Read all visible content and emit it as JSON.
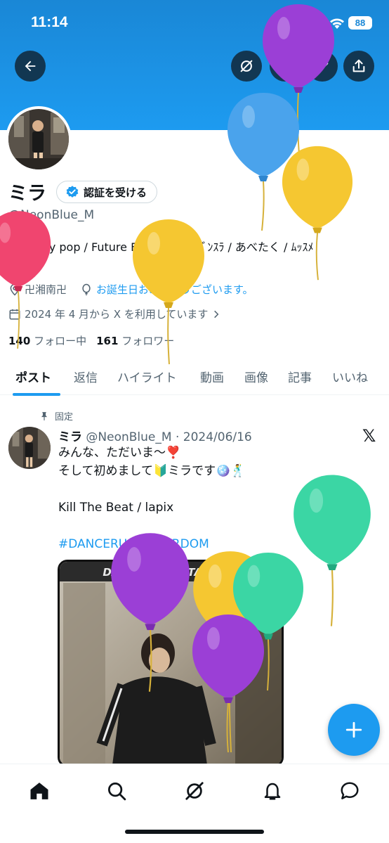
{
  "status_bar": {
    "time": "11:14",
    "battery": "88"
  },
  "profile": {
    "name": "ミラ",
    "verify_label": "認証を受ける",
    "handle": "@NeonBlue_M",
    "bio_line1": "❤️：City pop / Future Funk🌃🍸 / ﾀﾞﾝｽﾗ / あべたく / ﾑｯｽﾒ",
    "bio_line2": "(0)",
    "location": "卍湘南卍",
    "birthday": "お誕生日おめでとうございます。",
    "joined": "2024 年 4 月から X を利用しています",
    "following_count": "140",
    "following_label": "フォロー中",
    "followers_count": "161",
    "followers_label": "フォロワー"
  },
  "tabs": [
    "ポスト",
    "返信",
    "ハイライト",
    "動画",
    "画像",
    "記事",
    "いいね"
  ],
  "tweet": {
    "pinned_label": "固定",
    "name": "ミラ",
    "handle_date": "@NeonBlue_M · 2024/06/16",
    "lines": [
      "みんな、ただいま〜❣️",
      "そして初めまして🔰ミラです🪩🕺",
      "",
      "Kill The Beat / lapix",
      "",
      "#DANCERUSH_STARDOM"
    ],
    "media_caption": "DANCERUSH STARDOM"
  },
  "icons": {
    "header": [
      "back-arrow-icon",
      "grok-icon",
      "search-icon",
      "edit-icon",
      "share-icon"
    ],
    "nav": [
      "home-icon",
      "search-icon",
      "grok-icon",
      "notifications-icon",
      "messages-icon"
    ]
  },
  "colors": {
    "accent": "#1d9bf0",
    "banner": "#1a87d6",
    "balloon_purple": "#9b3fd6",
    "balloon_blue": "#4aa3ec",
    "balloon_yellow": "#f5c731",
    "balloon_pink": "#f0456f",
    "balloon_green": "#3bd6a4"
  }
}
